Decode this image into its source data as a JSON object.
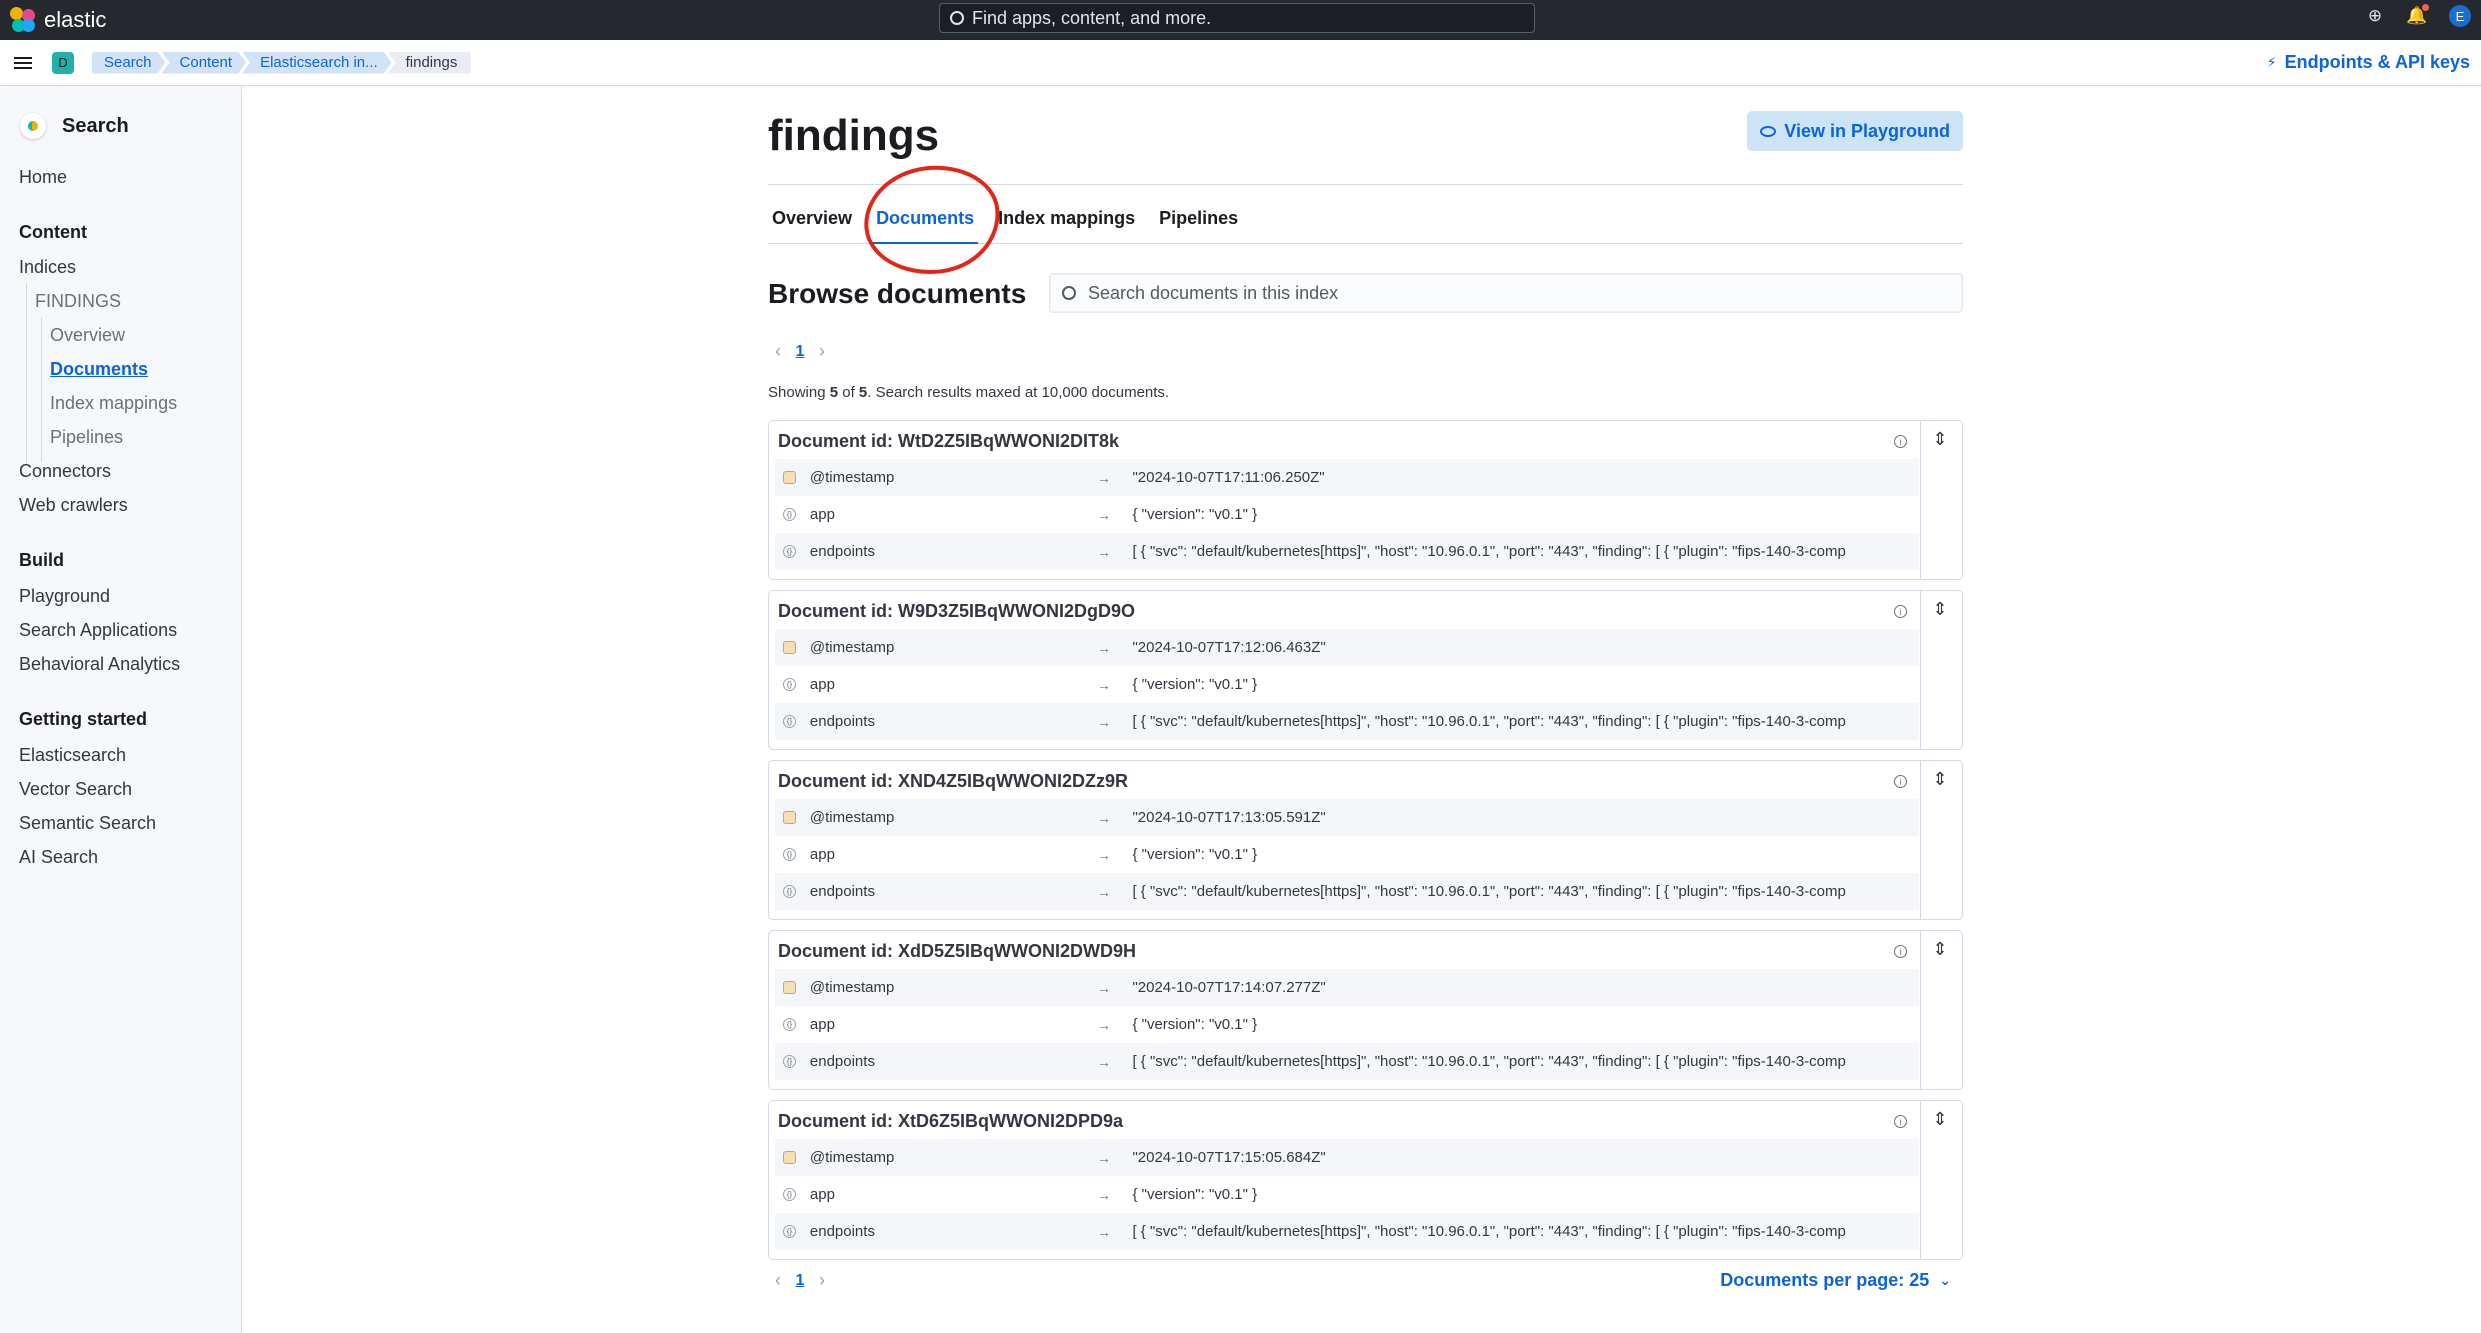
{
  "app": {
    "name": "elastic",
    "global_search_placeholder": "Find apps, content, and more.",
    "avatar_initial": "E",
    "space_initial": "D",
    "endpoints_label": "Endpoints & API keys"
  },
  "breadcrumbs": [
    "Search",
    "Content",
    "Elasticsearch in...",
    "findings"
  ],
  "sidebar": {
    "title": "Search",
    "home": "Home",
    "content_group": "Content",
    "indices": "Indices",
    "index_name": "FINDINGS",
    "index_children": [
      "Overview",
      "Documents",
      "Index mappings",
      "Pipelines"
    ],
    "connectors": "Connectors",
    "web_crawlers": "Web crawlers",
    "build_group": "Build",
    "build_items": [
      "Playground",
      "Search Applications",
      "Behavioral Analytics"
    ],
    "getting_started_group": "Getting started",
    "getting_started_items": [
      "Elasticsearch",
      "Vector Search",
      "Semantic Search",
      "AI Search"
    ]
  },
  "page": {
    "title": "findings",
    "playground_button": "View in Playground",
    "tabs": [
      "Overview",
      "Documents",
      "Index mappings",
      "Pipelines"
    ],
    "active_tab": "Documents",
    "browse_title": "Browse documents",
    "doc_search_placeholder": "Search documents in this index",
    "page_number": "1",
    "showing_prefix": "Showing ",
    "showing_count": "5",
    "showing_of": " of ",
    "showing_total": "5",
    "showing_suffix": ". Search results maxed at 10,000 documents.",
    "per_page_label": "Documents per page: 25"
  },
  "documents": [
    {
      "id": "Document id: WtD2Z5IBqWWONI2DIT8k",
      "timestamp": "\"2024-10-07T17:11:06.250Z\""
    },
    {
      "id": "Document id: W9D3Z5IBqWWONI2DgD9O",
      "timestamp": "\"2024-10-07T17:12:06.463Z\""
    },
    {
      "id": "Document id: XND4Z5IBqWWONI2DZz9R",
      "timestamp": "\"2024-10-07T17:13:05.591Z\""
    },
    {
      "id": "Document id: XdD5Z5IBqWWONI2DWD9H",
      "timestamp": "\"2024-10-07T17:14:07.277Z\""
    },
    {
      "id": "Document id: XtD6Z5IBqWWONI2DPD9a",
      "timestamp": "\"2024-10-07T17:15:05.684Z\""
    }
  ],
  "fields": {
    "timestamp_name": "@timestamp",
    "app_name": "app",
    "app_value": "{ \"version\": \"v0.1\" }",
    "endpoints_name": "endpoints",
    "endpoints_value": "[ { \"svc\": \"default/kubernetes[https]\", \"host\": \"10.96.0.1\", \"port\": \"443\", \"finding\": [ { \"plugin\": \"fips-140-3-comp"
  },
  "colors": {
    "accent": "#0b64dd",
    "header_bg": "#25282f",
    "annotation": "#e0281a"
  }
}
